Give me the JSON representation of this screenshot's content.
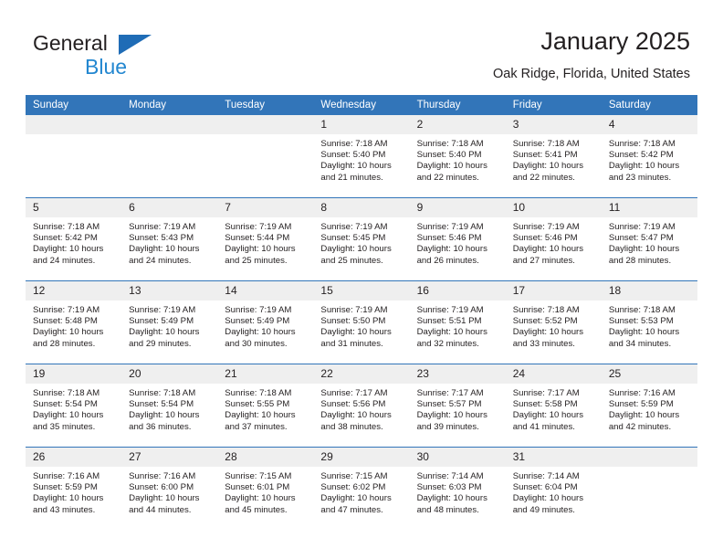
{
  "brand": {
    "line1": "General",
    "line2": "Blue",
    "triangle_color": "#1f6cb6",
    "line2_color": "#2387d0"
  },
  "header": {
    "title": "January 2025",
    "subtitle": "Oak Ridge, Florida, United States",
    "accent_color": "#3275b9"
  },
  "calendar": {
    "weekday_headers": [
      "Sunday",
      "Monday",
      "Tuesday",
      "Wednesday",
      "Thursday",
      "Friday",
      "Saturday"
    ],
    "weeks": [
      [
        {
          "day": "",
          "lines": []
        },
        {
          "day": "",
          "lines": []
        },
        {
          "day": "",
          "lines": []
        },
        {
          "day": "1",
          "lines": [
            "Sunrise: 7:18 AM",
            "Sunset: 5:40 PM",
            "Daylight: 10 hours",
            "and 21 minutes."
          ]
        },
        {
          "day": "2",
          "lines": [
            "Sunrise: 7:18 AM",
            "Sunset: 5:40 PM",
            "Daylight: 10 hours",
            "and 22 minutes."
          ]
        },
        {
          "day": "3",
          "lines": [
            "Sunrise: 7:18 AM",
            "Sunset: 5:41 PM",
            "Daylight: 10 hours",
            "and 22 minutes."
          ]
        },
        {
          "day": "4",
          "lines": [
            "Sunrise: 7:18 AM",
            "Sunset: 5:42 PM",
            "Daylight: 10 hours",
            "and 23 minutes."
          ]
        }
      ],
      [
        {
          "day": "5",
          "lines": [
            "Sunrise: 7:18 AM",
            "Sunset: 5:42 PM",
            "Daylight: 10 hours",
            "and 24 minutes."
          ]
        },
        {
          "day": "6",
          "lines": [
            "Sunrise: 7:19 AM",
            "Sunset: 5:43 PM",
            "Daylight: 10 hours",
            "and 24 minutes."
          ]
        },
        {
          "day": "7",
          "lines": [
            "Sunrise: 7:19 AM",
            "Sunset: 5:44 PM",
            "Daylight: 10 hours",
            "and 25 minutes."
          ]
        },
        {
          "day": "8",
          "lines": [
            "Sunrise: 7:19 AM",
            "Sunset: 5:45 PM",
            "Daylight: 10 hours",
            "and 25 minutes."
          ]
        },
        {
          "day": "9",
          "lines": [
            "Sunrise: 7:19 AM",
            "Sunset: 5:46 PM",
            "Daylight: 10 hours",
            "and 26 minutes."
          ]
        },
        {
          "day": "10",
          "lines": [
            "Sunrise: 7:19 AM",
            "Sunset: 5:46 PM",
            "Daylight: 10 hours",
            "and 27 minutes."
          ]
        },
        {
          "day": "11",
          "lines": [
            "Sunrise: 7:19 AM",
            "Sunset: 5:47 PM",
            "Daylight: 10 hours",
            "and 28 minutes."
          ]
        }
      ],
      [
        {
          "day": "12",
          "lines": [
            "Sunrise: 7:19 AM",
            "Sunset: 5:48 PM",
            "Daylight: 10 hours",
            "and 28 minutes."
          ]
        },
        {
          "day": "13",
          "lines": [
            "Sunrise: 7:19 AM",
            "Sunset: 5:49 PM",
            "Daylight: 10 hours",
            "and 29 minutes."
          ]
        },
        {
          "day": "14",
          "lines": [
            "Sunrise: 7:19 AM",
            "Sunset: 5:49 PM",
            "Daylight: 10 hours",
            "and 30 minutes."
          ]
        },
        {
          "day": "15",
          "lines": [
            "Sunrise: 7:19 AM",
            "Sunset: 5:50 PM",
            "Daylight: 10 hours",
            "and 31 minutes."
          ]
        },
        {
          "day": "16",
          "lines": [
            "Sunrise: 7:19 AM",
            "Sunset: 5:51 PM",
            "Daylight: 10 hours",
            "and 32 minutes."
          ]
        },
        {
          "day": "17",
          "lines": [
            "Sunrise: 7:18 AM",
            "Sunset: 5:52 PM",
            "Daylight: 10 hours",
            "and 33 minutes."
          ]
        },
        {
          "day": "18",
          "lines": [
            "Sunrise: 7:18 AM",
            "Sunset: 5:53 PM",
            "Daylight: 10 hours",
            "and 34 minutes."
          ]
        }
      ],
      [
        {
          "day": "19",
          "lines": [
            "Sunrise: 7:18 AM",
            "Sunset: 5:54 PM",
            "Daylight: 10 hours",
            "and 35 minutes."
          ]
        },
        {
          "day": "20",
          "lines": [
            "Sunrise: 7:18 AM",
            "Sunset: 5:54 PM",
            "Daylight: 10 hours",
            "and 36 minutes."
          ]
        },
        {
          "day": "21",
          "lines": [
            "Sunrise: 7:18 AM",
            "Sunset: 5:55 PM",
            "Daylight: 10 hours",
            "and 37 minutes."
          ]
        },
        {
          "day": "22",
          "lines": [
            "Sunrise: 7:17 AM",
            "Sunset: 5:56 PM",
            "Daylight: 10 hours",
            "and 38 minutes."
          ]
        },
        {
          "day": "23",
          "lines": [
            "Sunrise: 7:17 AM",
            "Sunset: 5:57 PM",
            "Daylight: 10 hours",
            "and 39 minutes."
          ]
        },
        {
          "day": "24",
          "lines": [
            "Sunrise: 7:17 AM",
            "Sunset: 5:58 PM",
            "Daylight: 10 hours",
            "and 41 minutes."
          ]
        },
        {
          "day": "25",
          "lines": [
            "Sunrise: 7:16 AM",
            "Sunset: 5:59 PM",
            "Daylight: 10 hours",
            "and 42 minutes."
          ]
        }
      ],
      [
        {
          "day": "26",
          "lines": [
            "Sunrise: 7:16 AM",
            "Sunset: 5:59 PM",
            "Daylight: 10 hours",
            "and 43 minutes."
          ]
        },
        {
          "day": "27",
          "lines": [
            "Sunrise: 7:16 AM",
            "Sunset: 6:00 PM",
            "Daylight: 10 hours",
            "and 44 minutes."
          ]
        },
        {
          "day": "28",
          "lines": [
            "Sunrise: 7:15 AM",
            "Sunset: 6:01 PM",
            "Daylight: 10 hours",
            "and 45 minutes."
          ]
        },
        {
          "day": "29",
          "lines": [
            "Sunrise: 7:15 AM",
            "Sunset: 6:02 PM",
            "Daylight: 10 hours",
            "and 47 minutes."
          ]
        },
        {
          "day": "30",
          "lines": [
            "Sunrise: 7:14 AM",
            "Sunset: 6:03 PM",
            "Daylight: 10 hours",
            "and 48 minutes."
          ]
        },
        {
          "day": "31",
          "lines": [
            "Sunrise: 7:14 AM",
            "Sunset: 6:04 PM",
            "Daylight: 10 hours",
            "and 49 minutes."
          ]
        },
        {
          "day": "",
          "lines": []
        }
      ]
    ]
  }
}
